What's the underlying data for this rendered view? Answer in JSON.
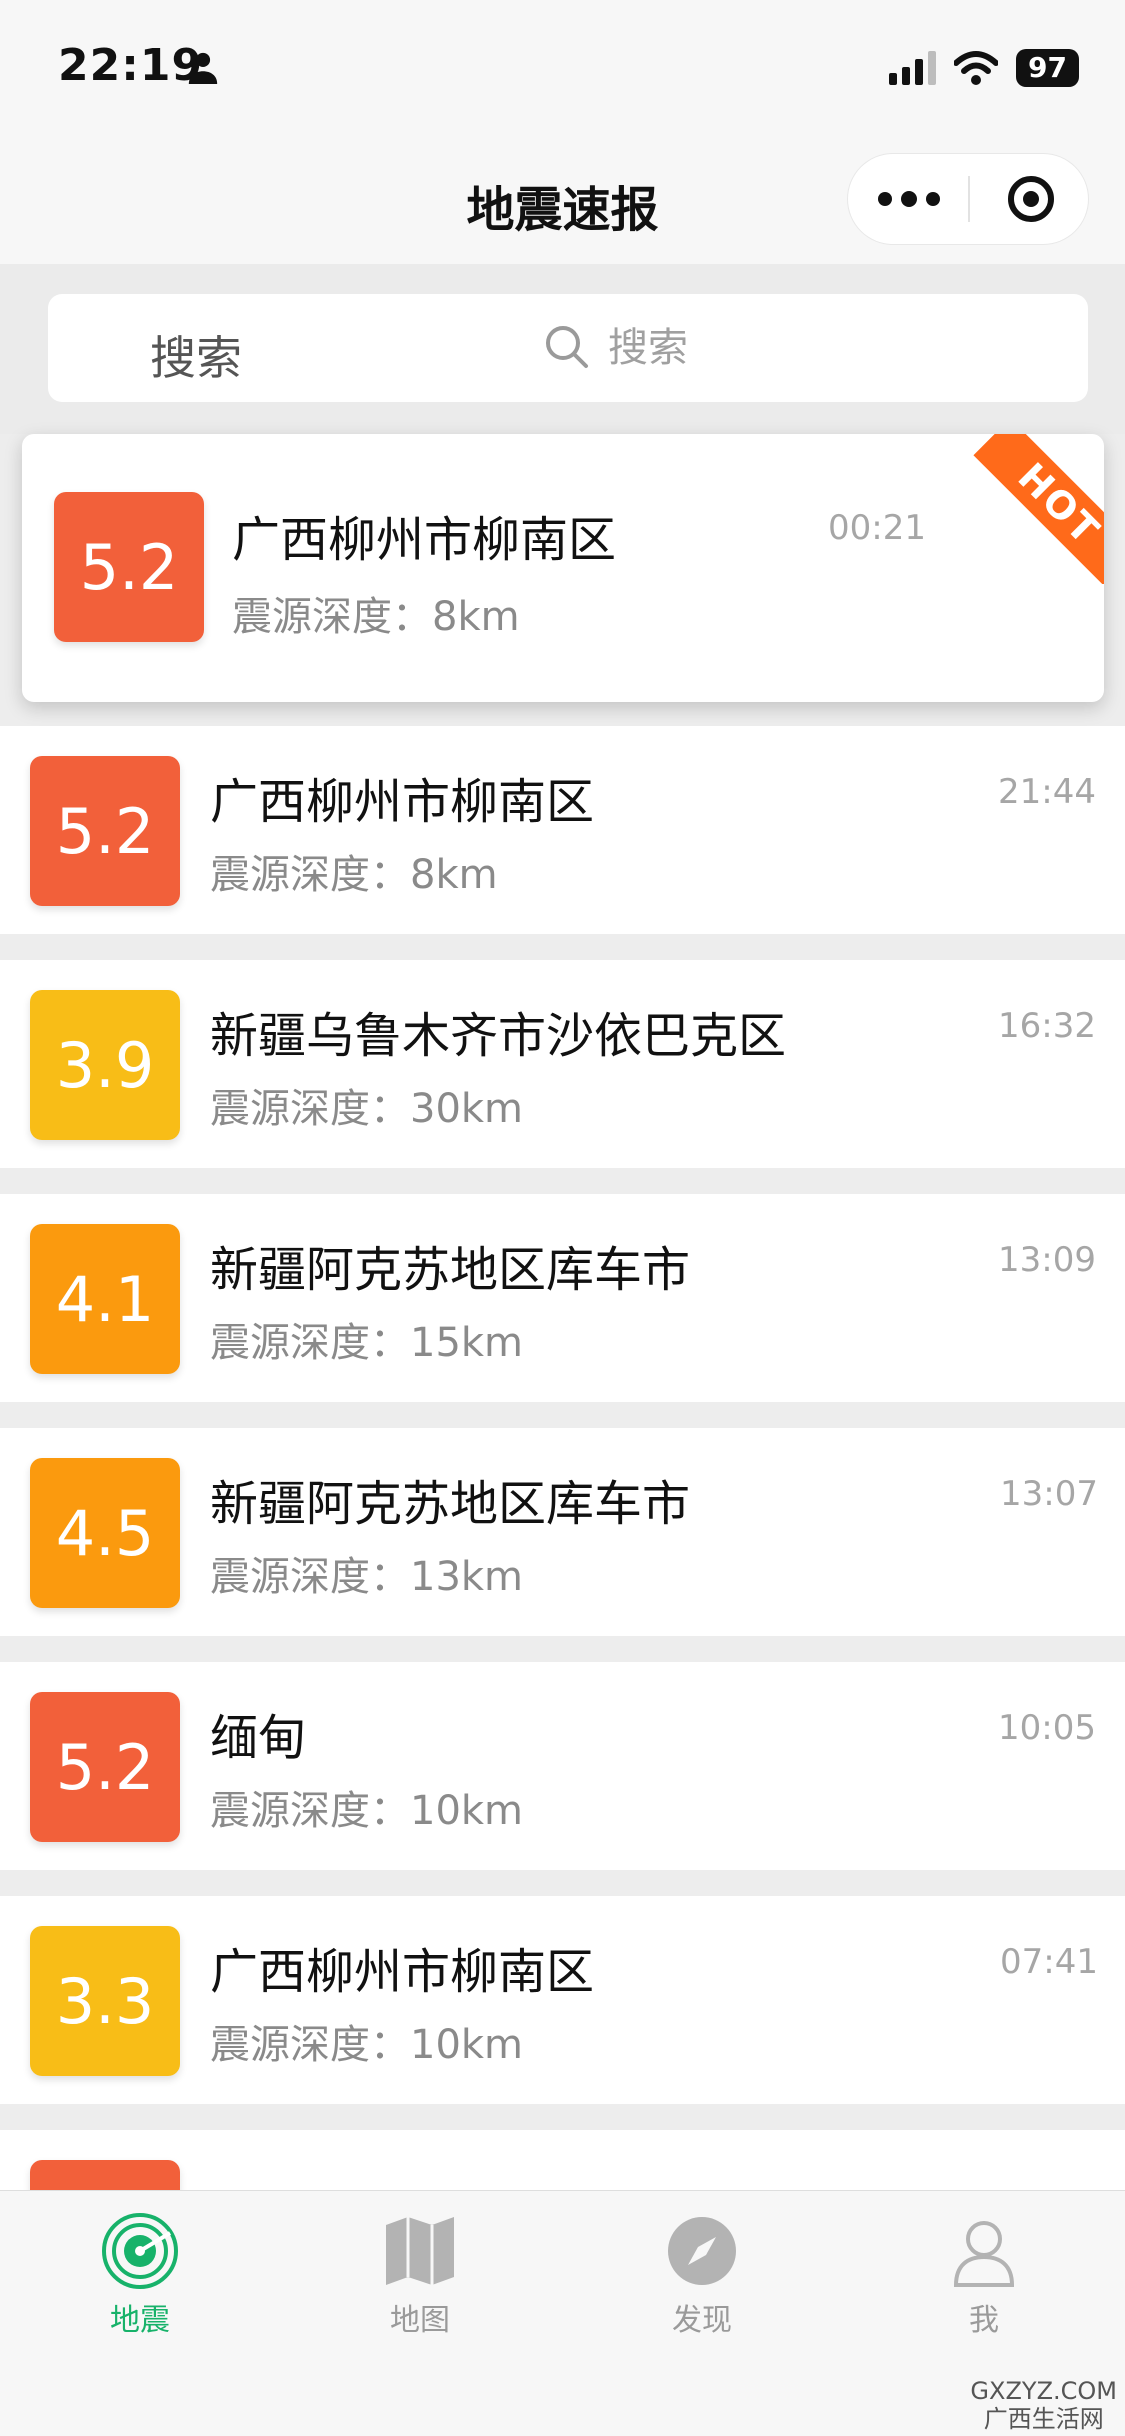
{
  "status_bar": {
    "time": "22:19",
    "battery": "97"
  },
  "nav": {
    "title": "地震速报"
  },
  "search": {
    "label": "搜索",
    "placeholder": "搜索"
  },
  "featured": {
    "magnitude": "5.2",
    "place": "广西柳州市柳南区",
    "depth": "震源深度：8km",
    "time": "00:21",
    "badge": "HOT",
    "color": "#f2603a"
  },
  "quakes": [
    {
      "magnitude": "5.2",
      "place": "广西柳州市柳南区",
      "depth": "震源深度：8km",
      "time": "21:44",
      "color": "#f2603a"
    },
    {
      "magnitude": "3.9",
      "place": "新疆乌鲁木齐市沙依巴克区",
      "depth": "震源深度：30km",
      "time": "16:32",
      "color": "#f8bd17"
    },
    {
      "magnitude": "4.1",
      "place": "新疆阿克苏地区库车市",
      "depth": "震源深度：15km",
      "time": "13:09",
      "color": "#fb9a0e"
    },
    {
      "magnitude": "4.5",
      "place": "新疆阿克苏地区库车市",
      "depth": "震源深度：13km",
      "time": "13:07",
      "color": "#fb9a0e"
    },
    {
      "magnitude": "5.2",
      "place": "缅甸",
      "depth": "震源深度：10km",
      "time": "10:05",
      "color": "#f2603a"
    },
    {
      "magnitude": "3.3",
      "place": "广西柳州市柳南区",
      "depth": "震源深度：10km",
      "time": "07:41",
      "color": "#f8bd17"
    }
  ],
  "tabs": [
    {
      "label": "地震",
      "icon": "radar-icon",
      "active": true
    },
    {
      "label": "地图",
      "icon": "map-icon",
      "active": false
    },
    {
      "label": "发现",
      "icon": "compass-icon",
      "active": false
    },
    {
      "label": "我",
      "icon": "user-icon",
      "active": false
    }
  ],
  "watermark": {
    "line1": "GXZYZ.COM",
    "line2": "广西生活网"
  },
  "colors": {
    "accent": "#17b26a",
    "tab_inactive": "#9a9a9a"
  }
}
